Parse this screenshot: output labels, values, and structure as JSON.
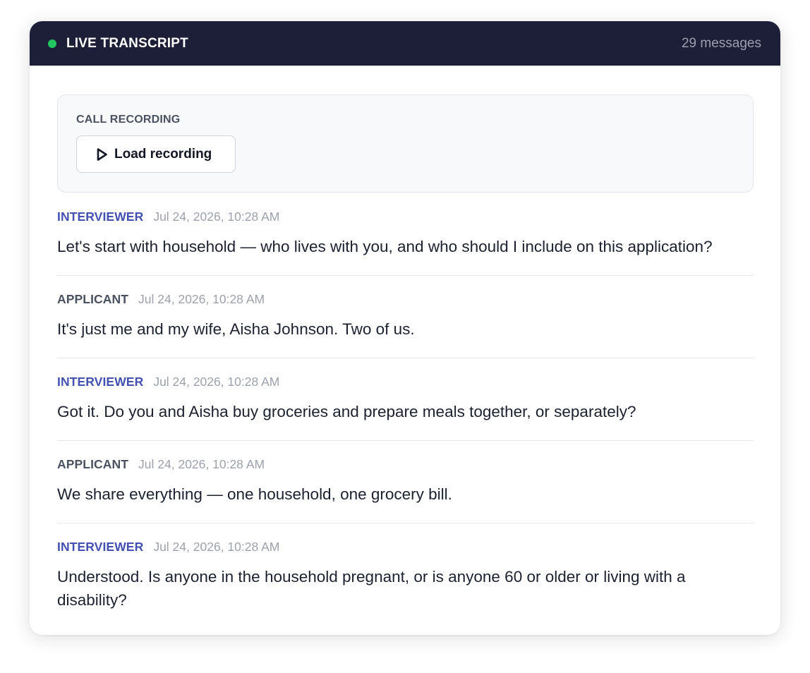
{
  "header": {
    "title": "LIVE TRANSCRIPT",
    "message_count": "29 messages",
    "live_color": "#22c55e"
  },
  "recording": {
    "label": "CALL RECORDING",
    "button_label": "Load recording",
    "button_icon": "play-icon"
  },
  "colors": {
    "header_bg": "#1c1f37",
    "interviewer": "#4451b3",
    "applicant": "#4a5160"
  },
  "messages": [
    {
      "speaker": "INTERVIEWER",
      "role": "interviewer",
      "timestamp": "Jul 24, 2026, 10:28 AM",
      "text": "Let's start with household — who lives with you, and who should I include on this application?"
    },
    {
      "speaker": "APPLICANT",
      "role": "applicant",
      "timestamp": "Jul 24, 2026, 10:28 AM",
      "text": "It's just me and my wife, Aisha Johnson. Two of us."
    },
    {
      "speaker": "INTERVIEWER",
      "role": "interviewer",
      "timestamp": "Jul 24, 2026, 10:28 AM",
      "text": "Got it. Do you and Aisha buy groceries and prepare meals together, or separately?"
    },
    {
      "speaker": "APPLICANT",
      "role": "applicant",
      "timestamp": "Jul 24, 2026, 10:28 AM",
      "text": "We share everything — one household, one grocery bill."
    },
    {
      "speaker": "INTERVIEWER",
      "role": "interviewer",
      "timestamp": "Jul 24, 2026, 10:28 AM",
      "text": "Understood. Is anyone in the household pregnant, or is anyone 60 or older or living with a disability?"
    }
  ]
}
